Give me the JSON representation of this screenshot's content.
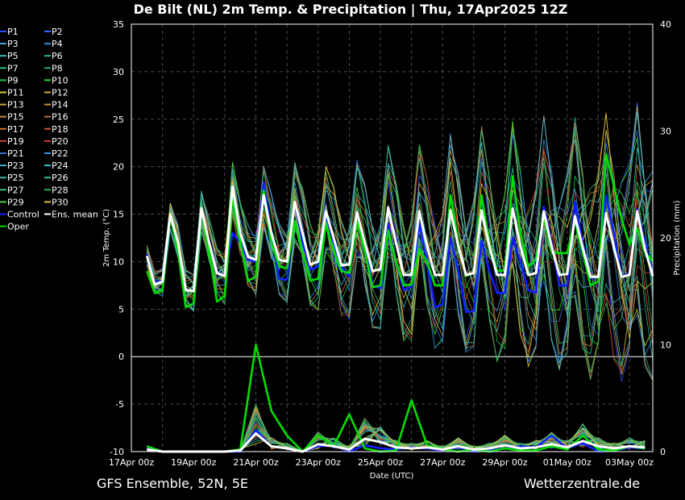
{
  "chart_data": {
    "type": "line",
    "title": "De Bilt  (NL)  2m Temp. & Precipitation | Thu, 17Apr2025 12Z",
    "xlabel": "Date (UTC)",
    "ylabel": "2m Temp. (°C)",
    "y2label": "Precipitation (mm)",
    "ylim": [
      -10,
      35
    ],
    "y2lim": [
      0,
      40
    ],
    "yticks": [
      "35",
      "30",
      "25",
      "20",
      "15",
      "10",
      "5",
      "0",
      "-5",
      "-10"
    ],
    "y2ticks": [
      "40",
      "30",
      "20",
      "10",
      "0"
    ],
    "x_tick_labels": [
      "17Apr 00z",
      "19Apr 00z",
      "21Apr 00z",
      "23Apr 00z",
      "25Apr 00z",
      "27Apr 00z",
      "29Apr 00z",
      "01May 00z",
      "03May 00z"
    ],
    "grid": true,
    "legend_position": "left",
    "legend": [
      "P1",
      "P2",
      "P3",
      "P4",
      "P5",
      "P6",
      "P7",
      "P8",
      "P9",
      "P10",
      "P11",
      "P12",
      "P13",
      "P14",
      "P15",
      "P16",
      "P17",
      "P18",
      "P19",
      "P20",
      "P21",
      "P22",
      "P23",
      "P24",
      "P25",
      "P26",
      "P27",
      "P28",
      "P29",
      "P30",
      "Control",
      "Ens. mean",
      "Oper"
    ],
    "temperature": {
      "times": [
        "17Apr 12z",
        "17Apr 18z",
        "18Apr 00z",
        "18Apr 06z",
        "18Apr 12z",
        "18Apr 18z",
        "19Apr 00z",
        "19Apr 06z",
        "19Apr 12z",
        "19Apr 18z",
        "20Apr 00z",
        "20Apr 06z",
        "20Apr 12z",
        "20Apr 18z",
        "21Apr 00z",
        "21Apr 06z",
        "21Apr 12z",
        "21Apr 18z",
        "22Apr 00z",
        "22Apr 06z",
        "22Apr 12z",
        "22Apr 18z",
        "23Apr 00z",
        "23Apr 06z",
        "23Apr 12z",
        "23Apr 18z",
        "24Apr 00z",
        "24Apr 06z",
        "24Apr 12z",
        "24Apr 18z",
        "25Apr 00z",
        "25Apr 06z",
        "25Apr 12z",
        "25Apr 18z",
        "26Apr 00z",
        "26Apr 06z",
        "26Apr 12z",
        "26Apr 18z",
        "27Apr 00z",
        "27Apr 06z",
        "27Apr 12z",
        "27Apr 18z",
        "28Apr 00z",
        "28Apr 06z",
        "28Apr 12z",
        "28Apr 18z",
        "29Apr 00z",
        "29Apr 06z",
        "29Apr 12z",
        "29Apr 18z",
        "30Apr 00z",
        "30Apr 06z",
        "30Apr 12z",
        "30Apr 18z",
        "01May 00z",
        "01May 06z",
        "01May 12z",
        "01May 18z",
        "02May 00z",
        "02May 06z",
        "02May 12z",
        "02May 18z",
        "03May 00z",
        "03May 06z",
        "03May 12z",
        "03May 18z"
      ],
      "ens_mean": [
        10.6,
        7.6,
        7.9,
        15.0,
        12.0,
        7.0,
        6.9,
        15.6,
        12.0,
        8.8,
        8.5,
        17.9,
        13.0,
        10.5,
        10.2,
        17.0,
        13.0,
        10.2,
        10.0,
        16.3,
        13.0,
        9.7,
        10.0,
        15.3,
        12.5,
        9.6,
        9.7,
        15.2,
        12.0,
        9.0,
        9.2,
        15.7,
        12.0,
        8.6,
        8.6,
        15.3,
        11.7,
        8.6,
        8.6,
        15.4,
        11.7,
        8.6,
        8.8,
        15.4,
        11.6,
        8.6,
        8.6,
        15.6,
        11.6,
        8.6,
        8.8,
        15.3,
        11.6,
        8.6,
        8.7,
        14.8,
        11.5,
        8.4,
        8.4,
        15.1,
        11.5,
        8.4,
        8.6,
        15.3,
        11.3,
        8.5
      ],
      "control": [
        10.8,
        7.8,
        8.0,
        15.0,
        12.0,
        7.0,
        6.9,
        15.5,
        12.0,
        8.9,
        8.5,
        13.0,
        12.0,
        10.2,
        10.0,
        18.3,
        13.0,
        8.2,
        8.1,
        16.3,
        12.0,
        9.2,
        9.5,
        15.0,
        12.0,
        9.5,
        8.4,
        15.0,
        12.0,
        7.5,
        7.2,
        14.0,
        10.0,
        7.0,
        7.4,
        14.0,
        10.0,
        5.2,
        5.5,
        12.5,
        9.0,
        4.7,
        4.8,
        12.2,
        9.0,
        6.7,
        6.7,
        12.5,
        10.0,
        7.0,
        6.7,
        15.8,
        12.0,
        7.5,
        7.5,
        16.3,
        12.0,
        8.2,
        8.5,
        17.0,
        13.0,
        8.4,
        8.8,
        15.5,
        12.0,
        8.8
      ],
      "oper": [
        9.0,
        6.7,
        7.0,
        14.8,
        11.0,
        5.2,
        5.6,
        15.5,
        11.0,
        5.8,
        6.4,
        16.8,
        12.0,
        8.0,
        8.4,
        17.5,
        12.0,
        9.5,
        9.3,
        14.3,
        11.0,
        8.0,
        8.2,
        14.0,
        11.0,
        9.0,
        8.8,
        14.3,
        11.0,
        7.3,
        7.5,
        13.3,
        10.0,
        7.5,
        7.6,
        11.3,
        10.0,
        7.5,
        7.5,
        17.0,
        12.0,
        8.5,
        8.8,
        17.0,
        12.0,
        9.0,
        9.1,
        19.0,
        13.0,
        9.5,
        10.2,
        14.8,
        11.0,
        10.9,
        10.9,
        14.3,
        11.0,
        7.5,
        7.9,
        21.3,
        18.0,
        14.5,
        11.8,
        13.5,
        11.0,
        10.0
      ]
    },
    "precipitation": {
      "times": [
        "17Apr 12z",
        "18Apr 00z",
        "18Apr 12z",
        "19Apr 00z",
        "19Apr 12z",
        "20Apr 00z",
        "20Apr 12z",
        "21Apr 00z",
        "21Apr 12z",
        "22Apr 00z",
        "22Apr 12z",
        "23Apr 00z",
        "23Apr 12z",
        "24Apr 00z",
        "24Apr 12z",
        "25Apr 00z",
        "25Apr 12z",
        "26Apr 00z",
        "26Apr 12z",
        "27Apr 00z",
        "27Apr 12z",
        "28Apr 00z",
        "28Apr 12z",
        "29Apr 00z",
        "29Apr 12z",
        "30Apr 00z",
        "30Apr 12z",
        "01May 00z",
        "01May 12z",
        "02May 00z",
        "02May 12z",
        "03May 00z",
        "03May 12z"
      ],
      "ens_mean": [
        0.2,
        0.0,
        0.0,
        0.0,
        0.0,
        0.0,
        0.1,
        1.7,
        0.5,
        0.3,
        0.0,
        0.7,
        0.5,
        0.2,
        1.2,
        0.9,
        0.4,
        0.3,
        0.4,
        0.2,
        0.5,
        0.2,
        0.3,
        0.6,
        0.3,
        0.4,
        0.7,
        0.4,
        1.0,
        0.5,
        0.3,
        0.5,
        0.4
      ],
      "control": [
        0.3,
        0.0,
        0.0,
        0.0,
        0.0,
        0.0,
        0.0,
        2.0,
        0.5,
        0.3,
        0.0,
        0.5,
        0.6,
        0.0,
        0.6,
        0.3,
        0.2,
        0.4,
        0.3,
        0.1,
        0.4,
        0.0,
        0.1,
        0.3,
        0.5,
        0.4,
        1.5,
        0.3,
        0.8,
        0.0,
        0.1,
        0.4,
        0.3
      ],
      "oper": [
        0.5,
        0.0,
        0.0,
        0.0,
        0.0,
        0.0,
        0.2,
        10.0,
        3.8,
        1.5,
        0.0,
        1.5,
        0.5,
        3.5,
        0.3,
        0.0,
        0.1,
        4.8,
        0.6,
        0.2,
        0.0,
        0.2,
        0.0,
        0.3,
        0.1,
        0.1,
        0.5,
        0.2,
        1.5,
        0.2,
        0.1,
        0.5,
        0.3
      ]
    }
  },
  "footer": {
    "left": "GFS Ensemble, 52N, 5E",
    "right": "Wetterzentrale.de"
  }
}
